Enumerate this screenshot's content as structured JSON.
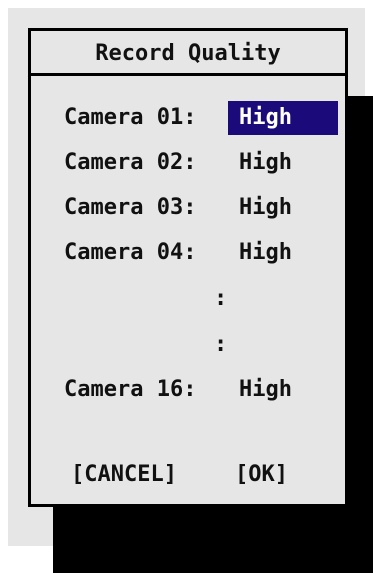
{
  "dialog": {
    "title": "Record Quality",
    "rows": [
      {
        "label": "Camera 01:",
        "value": "High",
        "selected": true
      },
      {
        "label": "Camera 02:",
        "value": "High"
      },
      {
        "label": "Camera 03:",
        "value": "High"
      },
      {
        "label": "Camera 04:",
        "value": "High"
      },
      {
        "label": "Camera 16:",
        "value": "High"
      }
    ],
    "ellipsis": [
      ":",
      ":"
    ],
    "cancel_label": "[CANCEL]",
    "ok_label": "[OK]"
  },
  "colors": {
    "panel_bg": "#e6e6e6",
    "border": "#000000",
    "shadow": "#000000",
    "selection_bg": "#1a0a7a",
    "selection_text": "#ffffff"
  }
}
